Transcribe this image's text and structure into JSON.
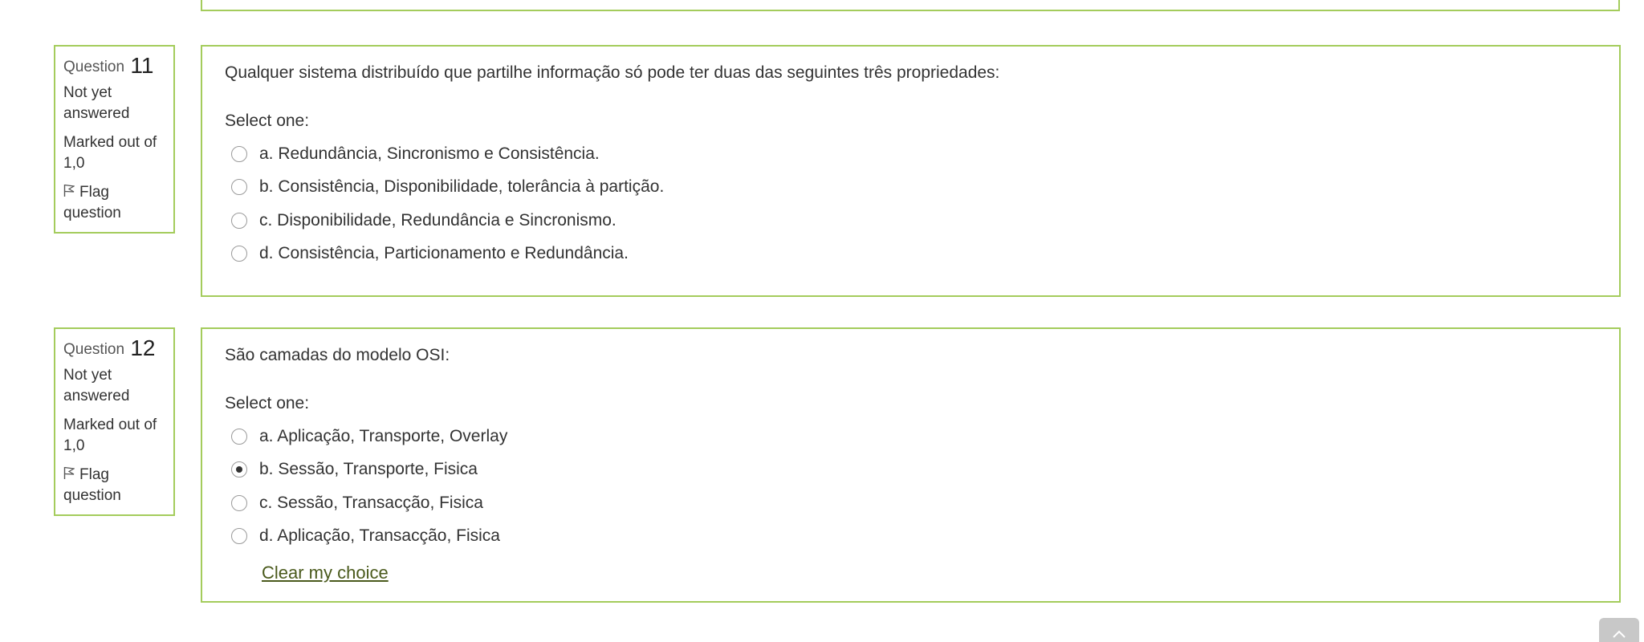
{
  "questions": [
    {
      "label": "Question",
      "number": "11",
      "state": "Not yet answered",
      "grade": "Marked out of 1,0",
      "flag_label": "Flag question",
      "text": "Qualquer sistema distribuído que partilhe informação só pode ter duas das seguintes três propriedades:",
      "prompt": "Select one:",
      "options": [
        "a. Redundância, Sincronismo e Consistência.",
        "b. Consistência, Disponibilidade, tolerância à partição.",
        "c. Disponibilidade, Redundância e Sincronismo.",
        "d. Consistência, Particionamento e Redundância."
      ],
      "selected": null
    },
    {
      "label": "Question",
      "number": "12",
      "state": "Not yet answered",
      "grade": "Marked out of 1,0",
      "flag_label": "Flag question",
      "text": "São camadas do modelo OSI:",
      "prompt": "Select one:",
      "options": [
        "a. Aplicação, Transporte, Overlay",
        "b. Sessão, Transporte, Fisica",
        "c. Sessão, Transacção, Fisica",
        "d. Aplicação, Transacção, Fisica"
      ],
      "selected": "b",
      "clear_label": "Clear my choice"
    }
  ],
  "icons": {
    "flag": "flag-icon",
    "back_to_top": "chevron-up-icon"
  },
  "colors": {
    "border": "#a4cc5c",
    "link": "#4a5a1c",
    "text": "#333333"
  }
}
